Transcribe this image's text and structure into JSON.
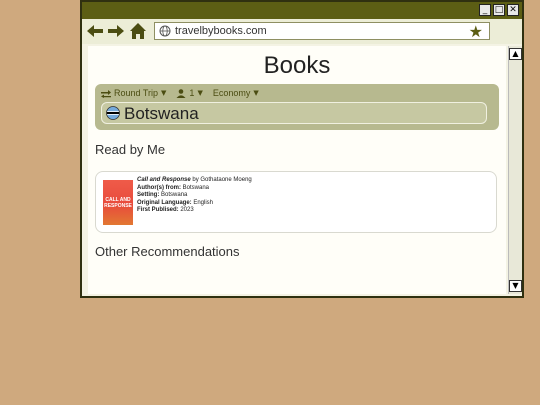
{
  "browser": {
    "url": "travelbybooks.com",
    "win_min": "_",
    "win_max": "□",
    "win_close": "✕"
  },
  "page": {
    "title": "Books",
    "trip_type": "Round Trip",
    "travelers": "1",
    "cabin": "Economy",
    "destination": "Botswana",
    "read_heading": "Read by Me",
    "other_heading": "Other Recommendations"
  },
  "book": {
    "title": "Call and Response",
    "by": "by",
    "author": "Gothataone Moeng",
    "cover_text": "CALL AND RESPONSE",
    "authors_from_label": "Author(s) from:",
    "authors_from": "Botswana",
    "setting_label": "Setting:",
    "setting": "Botswana",
    "language_label": "Original Language:",
    "language": "English",
    "published_label": "First Publised:",
    "published": "2023"
  },
  "colors": {
    "accent": "#5c5e14",
    "panel": "#b7b98f",
    "background": "#cfa97e"
  }
}
